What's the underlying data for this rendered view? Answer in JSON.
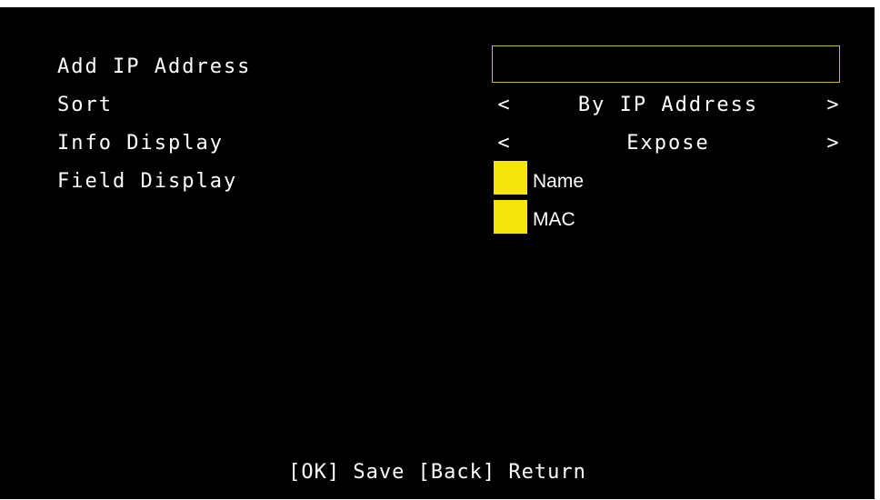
{
  "menu": {
    "add_ip_label": "Add IP Address",
    "sort_label": "Sort",
    "info_display_label": "Info Display",
    "field_display_label": "Field Display"
  },
  "ip_input": {
    "value": ""
  },
  "sort": {
    "left_arrow": "<",
    "value": "By IP Address",
    "right_arrow": ">"
  },
  "info_display": {
    "left_arrow": "<",
    "value": "Expose",
    "right_arrow": ">"
  },
  "field_display": {
    "options": [
      {
        "label": "Name",
        "checked": true
      },
      {
        "label": "MAC",
        "checked": true
      }
    ]
  },
  "footer": {
    "hint": "[OK] Save [Back] Return"
  },
  "colors": {
    "background": "#000000",
    "text": "#ffffff",
    "checkbox": "#f5e50a",
    "input_border": "#c8b84a"
  }
}
